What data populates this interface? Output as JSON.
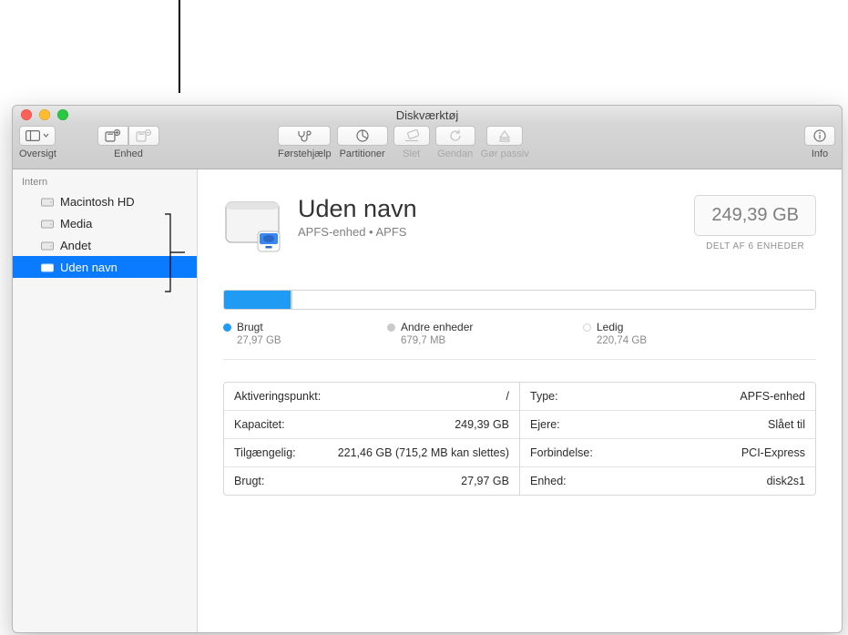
{
  "window": {
    "title": "Diskværktøj"
  },
  "toolbar": {
    "view": "Oversigt",
    "volume": "Enhed",
    "first_aid": "Førstehjælp",
    "partition": "Partitioner",
    "erase": "Slet",
    "restore": "Gendan",
    "unmount": "Gør passiv",
    "info": "Info"
  },
  "sidebar": {
    "section": "Intern",
    "items": [
      {
        "label": "Macintosh HD"
      },
      {
        "label": "Media"
      },
      {
        "label": "Andet"
      },
      {
        "label": "Uden navn",
        "selected": true
      }
    ]
  },
  "volume": {
    "title": "Uden navn",
    "subtitle": "APFS-enhed • APFS",
    "capacity": "249,39 GB",
    "capacity_sub": "DELT AF 6 ENHEDER"
  },
  "usage": {
    "used": {
      "label": "Brugt",
      "value": "27,97 GB",
      "color": "#1f9bf4"
    },
    "other": {
      "label": "Andre enheder",
      "value": "679,7 MB",
      "color": "#cacaca"
    },
    "free": {
      "label": "Ledig",
      "value": "220,74 GB",
      "color": "#ffffff"
    }
  },
  "info": {
    "left": [
      {
        "k": "Aktiveringspunkt:",
        "v": "/"
      },
      {
        "k": "Kapacitet:",
        "v": "249,39 GB"
      },
      {
        "k": "Tilgængelig:",
        "v": "221,46 GB (715,2 MB kan slettes)"
      },
      {
        "k": "Brugt:",
        "v": "27,97 GB"
      }
    ],
    "right": [
      {
        "k": "Type:",
        "v": "APFS-enhed"
      },
      {
        "k": "Ejere:",
        "v": "Slået til"
      },
      {
        "k": "Forbindelse:",
        "v": "PCI-Express"
      },
      {
        "k": "Enhed:",
        "v": "disk2s1"
      }
    ]
  }
}
